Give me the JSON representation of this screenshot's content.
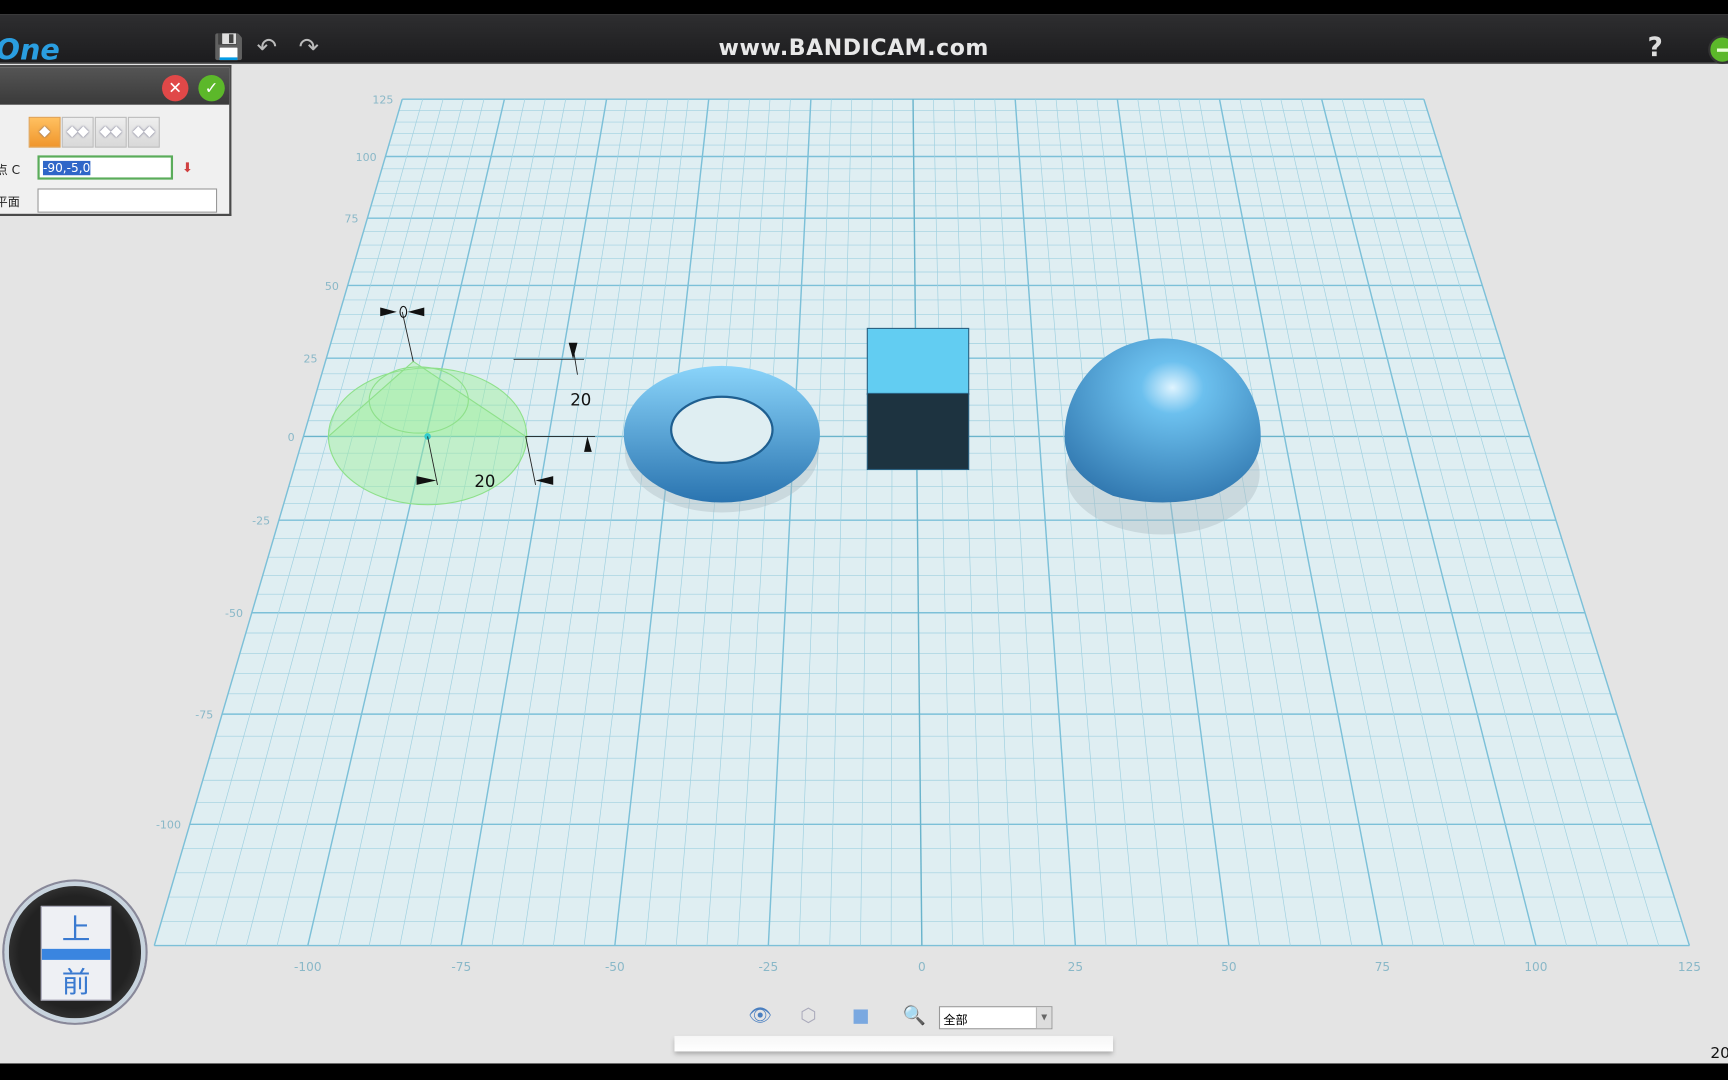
{
  "app": {
    "logo": "One",
    "watermark": "www.BANDICAM.com",
    "help": "?"
  },
  "toolbar": {
    "icons": [
      "save-icon",
      "undo-icon",
      "redo-icon"
    ]
  },
  "dialog": {
    "cancel": "✕",
    "ok": "✓",
    "modes": [
      "◆",
      "◆◆",
      "◆◆",
      "◆◆"
    ],
    "point_label": "点 C",
    "point_value": "-90,-5,0",
    "plane_label": "平面",
    "plane_value": ""
  },
  "viewport": {
    "x_ticks": [
      "-100",
      "-75",
      "-50",
      "-25",
      "0",
      "25",
      "50",
      "75",
      "100",
      "125"
    ],
    "y_ticks": [
      "125",
      "100",
      "75",
      "50",
      "25",
      "0",
      "-25",
      "-50",
      "-75",
      "-100"
    ],
    "dim_height": "20",
    "dim_radius": "20",
    "angle_handle": "0",
    "colors": {
      "grid": "#9fd0e0",
      "grid_major": "#7cc0d8",
      "objects": "#4a9fd8",
      "cone": "#9ef09a"
    }
  },
  "navcube": {
    "top": "上",
    "front": "前"
  },
  "bottom_toolbar": {
    "icons": [
      "eye-icon",
      "wireframe-cube-icon",
      "solid-cube-icon",
      "zoom-icon"
    ],
    "filter": "全部"
  },
  "corner_text": "20"
}
